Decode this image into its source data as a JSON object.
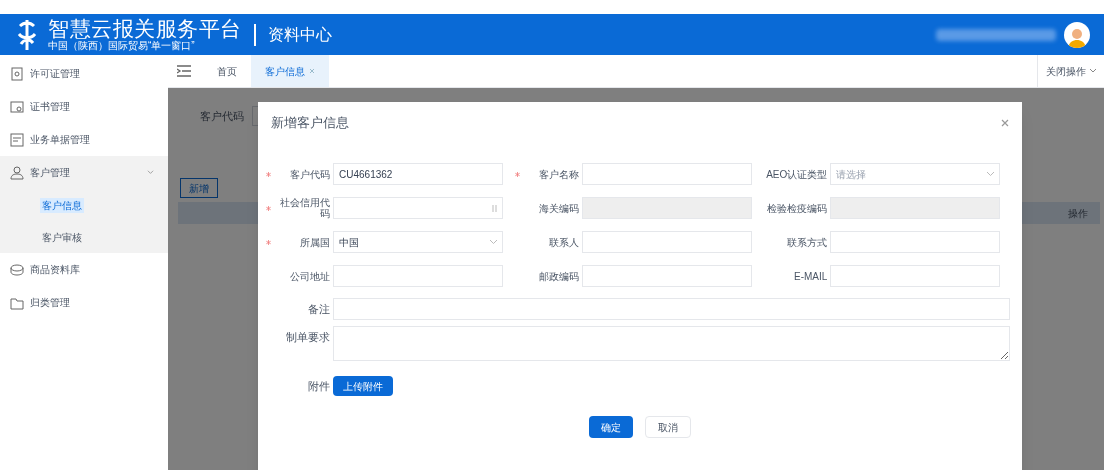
{
  "header": {
    "title": "智慧云报关服务平台",
    "subtitle": "中国（陕西）国际贸易“单一窗口”",
    "section": "资料中心"
  },
  "sidebar": {
    "items": [
      {
        "label": "许可证管理",
        "expanded": false
      },
      {
        "label": "证书管理",
        "expanded": false
      },
      {
        "label": "业务单据管理",
        "expanded": false
      },
      {
        "label": "客户管理",
        "expanded": true,
        "children": [
          {
            "label": "客户信息",
            "selected": true
          },
          {
            "label": "客户审核",
            "selected": false
          }
        ]
      },
      {
        "label": "商品资料库",
        "expanded": false
      },
      {
        "label": "归类管理",
        "expanded": false
      }
    ]
  },
  "tabs": [
    {
      "label": "首页",
      "selected": false,
      "closable": false
    },
    {
      "label": "客户信息",
      "selected": true,
      "closable": true
    }
  ],
  "tab_actions": {
    "label": "关闭操作"
  },
  "background": {
    "filter_label": "客户代码",
    "add_button": "新增",
    "column_header": "操作"
  },
  "dialog": {
    "title": "新增客户信息",
    "fields": [
      {
        "label": "客户代码",
        "required": true,
        "kind": "input",
        "value": "CU4661362"
      },
      {
        "label": "客户名称",
        "required": true,
        "kind": "input"
      },
      {
        "label": "AEO认证类型",
        "required": false,
        "kind": "select",
        "placeholder": "请选择"
      },
      {
        "label": "社会信用代码",
        "required": true,
        "kind": "lookup"
      },
      {
        "label": "海关编码",
        "required": false,
        "kind": "disabled"
      },
      {
        "label": "检验检疫编码",
        "required": false,
        "kind": "disabled"
      },
      {
        "label": "所属国",
        "required": true,
        "kind": "select",
        "value": "中国"
      },
      {
        "label": "联系人",
        "required": false,
        "kind": "input"
      },
      {
        "label": "联系方式",
        "required": false,
        "kind": "input"
      },
      {
        "label": "公司地址",
        "required": false,
        "kind": "input"
      },
      {
        "label": "邮政编码",
        "required": false,
        "kind": "input"
      },
      {
        "label": "E-MAIL",
        "required": false,
        "kind": "input"
      }
    ],
    "remark_label": "备注",
    "requirement_label": "制单要求",
    "attachment_label": "附件",
    "upload_button": "上传附件",
    "buttons": [
      {
        "label": "确定",
        "kind": "primary"
      },
      {
        "label": "取消",
        "kind": "default"
      }
    ]
  }
}
